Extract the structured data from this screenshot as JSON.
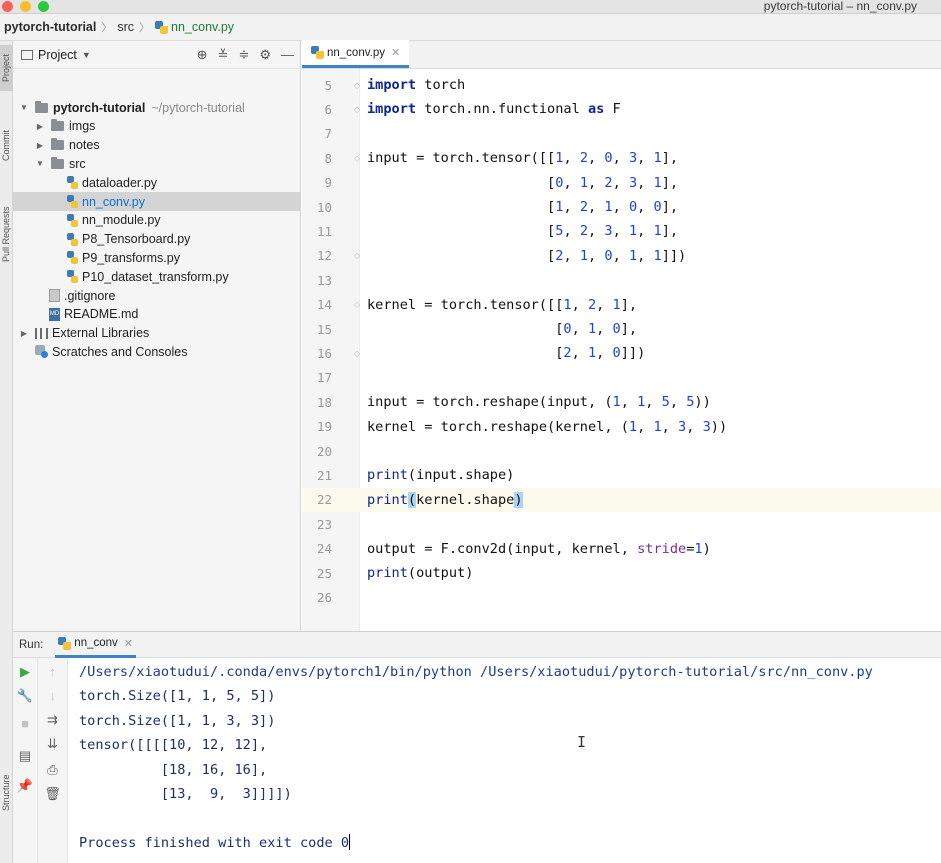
{
  "window": {
    "title": "pytorch-tutorial – nn_conv.py"
  },
  "breadcrumb": {
    "project": "pytorch-tutorial",
    "folder": "src",
    "file": "nn_conv.py"
  },
  "left_stripe": {
    "tabs": [
      "Project",
      "Commit",
      "Pull Requests",
      "Structure"
    ]
  },
  "project_panel": {
    "title": "Project",
    "tools": [
      "target-icon",
      "collapse-icon",
      "expand-icon",
      "gear-icon",
      "minimize-icon"
    ],
    "tree": [
      {
        "label": "pytorch-tutorial",
        "path": "~/pytorch-tutorial",
        "kind": "folder",
        "expanded": true,
        "depth": 0
      },
      {
        "label": "imgs",
        "kind": "folder",
        "expanded": false,
        "depth": 1
      },
      {
        "label": "notes",
        "kind": "folder",
        "expanded": false,
        "depth": 1
      },
      {
        "label": "src",
        "kind": "folder",
        "expanded": true,
        "depth": 1
      },
      {
        "label": "dataloader.py",
        "kind": "py",
        "depth": 2
      },
      {
        "label": "nn_conv.py",
        "kind": "py",
        "depth": 2,
        "selected": true
      },
      {
        "label": "nn_module.py",
        "kind": "py",
        "depth": 2
      },
      {
        "label": "P8_Tensorboard.py",
        "kind": "py",
        "depth": 2
      },
      {
        "label": "P9_transforms.py",
        "kind": "py",
        "depth": 2
      },
      {
        "label": "P10_dataset_transform.py",
        "kind": "py",
        "depth": 2
      },
      {
        "label": ".gitignore",
        "kind": "git",
        "depth": 1
      },
      {
        "label": "README.md",
        "kind": "md",
        "depth": 1
      },
      {
        "label": "External Libraries",
        "kind": "lib",
        "expanded": false,
        "depth": 0
      },
      {
        "label": "Scratches and Consoles",
        "kind": "scratch",
        "depth": 0
      }
    ]
  },
  "editor": {
    "tab_label": "nn_conv.py",
    "current_line": 22,
    "lines": [
      {
        "n": "5",
        "text": "import torch"
      },
      {
        "n": "6",
        "text": "import torch.nn.functional as F"
      },
      {
        "n": "7",
        "text": ""
      },
      {
        "n": "8",
        "text": "input = torch.tensor([[1, 2, 0, 3, 1],"
      },
      {
        "n": "9",
        "text": "                      [0, 1, 2, 3, 1],"
      },
      {
        "n": "10",
        "text": "                      [1, 2, 1, 0, 0],"
      },
      {
        "n": "11",
        "text": "                      [5, 2, 3, 1, 1],"
      },
      {
        "n": "12",
        "text": "                      [2, 1, 0, 1, 1]])"
      },
      {
        "n": "13",
        "text": ""
      },
      {
        "n": "14",
        "text": "kernel = torch.tensor([[1, 2, 1],"
      },
      {
        "n": "15",
        "text": "                       [0, 1, 0],"
      },
      {
        "n": "16",
        "text": "                       [2, 1, 0]])"
      },
      {
        "n": "17",
        "text": ""
      },
      {
        "n": "18",
        "text": "input = torch.reshape(input, (1, 1, 5, 5))"
      },
      {
        "n": "19",
        "text": "kernel = torch.reshape(kernel, (1, 1, 3, 3))"
      },
      {
        "n": "20",
        "text": ""
      },
      {
        "n": "21",
        "text": "print(input.shape)"
      },
      {
        "n": "22",
        "text": "print(kernel.shape)"
      },
      {
        "n": "23",
        "text": ""
      },
      {
        "n": "24",
        "text": "output = F.conv2d(input, kernel, stride=1)"
      },
      {
        "n": "25",
        "text": "print(output)"
      },
      {
        "n": "26",
        "text": ""
      }
    ]
  },
  "run_panel": {
    "label": "Run:",
    "tab_label": "nn_conv",
    "output": [
      "/Users/xiaotudui/.conda/envs/pytorch1/bin/python /Users/xiaotudui/pytorch-tutorial/src/nn_conv.py",
      "torch.Size([1, 1, 5, 5])",
      "torch.Size([1, 1, 3, 3])",
      "tensor([[[[10, 12, 12],",
      "          [18, 16, 16],",
      "          [13,  9,  3]]]])",
      "",
      "Process finished with exit code 0"
    ],
    "toolbar_left": [
      "run-icon",
      "wrench-icon",
      "stop-icon",
      "layout-icon",
      "pin-icon"
    ],
    "toolbar_right": [
      "up-arrow-icon",
      "down-arrow-icon",
      "soft-wrap-icon",
      "scroll-to-end-icon",
      "print-icon",
      "trash-icon"
    ]
  },
  "colors": {
    "keyword": "#0f2690",
    "number": "#1d3fe1",
    "parameter": "#7a2d98",
    "selection": "#d4d4d4",
    "tab_accent": "#4083c9",
    "current_line": "#fcfaed"
  }
}
